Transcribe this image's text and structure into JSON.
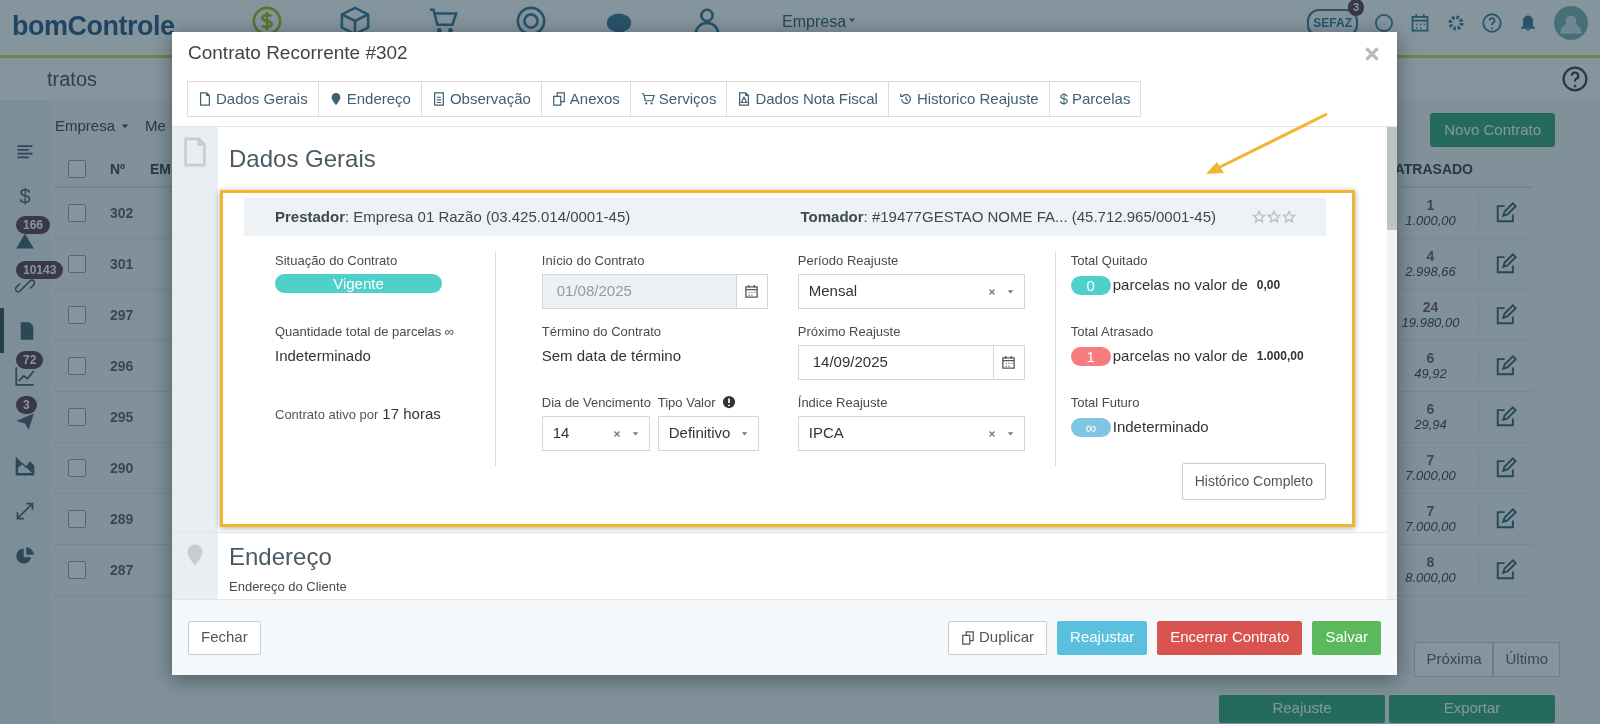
{
  "app": {
    "logo": "bomControle",
    "header_nav": [
      {
        "kind": "dollar",
        "selected": true
      },
      {
        "kind": "box",
        "selected": false
      },
      {
        "kind": "cart",
        "selected": false
      },
      {
        "kind": "target",
        "selected": false
      },
      {
        "kind": "piggy",
        "selected": false
      },
      {
        "kind": "people",
        "selected": false
      }
    ],
    "company_menu": "Empresa",
    "sefaz": {
      "label": "SEFAZ",
      "count": "3"
    },
    "page_title": "tratos",
    "filters": [
      "Empresa",
      "Me"
    ],
    "new_button": "Novo Contrato",
    "sidebar": [
      {
        "kind": "menu",
        "selected": false
      },
      {
        "kind": "dollar",
        "symbol": "$",
        "selected": false
      },
      {
        "kind": "warning",
        "badge": "166",
        "selected": false
      },
      {
        "kind": "link",
        "badge": "10143",
        "selected": false
      },
      {
        "kind": "document",
        "selected": true
      },
      {
        "kind": "chart",
        "badge": "72",
        "selected": false
      },
      {
        "kind": "send",
        "badge": "3",
        "selected": false
      },
      {
        "kind": "area",
        "selected": false
      },
      {
        "kind": "expand",
        "selected": false
      },
      {
        "kind": "pie",
        "selected": false
      }
    ],
    "table": {
      "columns": [
        "Nº",
        "EM",
        "ATRASADO"
      ],
      "select_all_checked": false,
      "rows": [
        {
          "checked": false,
          "number": "302",
          "late_count": "1",
          "late_value": "1.000,00"
        },
        {
          "checked": false,
          "number": "301",
          "late_count": "4",
          "late_value": "2.998,66"
        },
        {
          "checked": false,
          "number": "297",
          "late_count": "24",
          "late_value": "19.980,00"
        },
        {
          "checked": false,
          "number": "296",
          "late_count": "6",
          "late_value": "49,92"
        },
        {
          "checked": false,
          "number": "295",
          "late_count": "6",
          "late_value": "29,94"
        },
        {
          "checked": false,
          "number": "290",
          "late_count": "7",
          "late_value": "7.000,00"
        },
        {
          "checked": false,
          "number": "289",
          "late_count": "7",
          "late_value": "7.000,00"
        },
        {
          "checked": false,
          "number": "287",
          "late_count": "8",
          "late_value": "8.000,00"
        }
      ]
    },
    "pagination": [
      "Próxima",
      "Último"
    ],
    "bottom_buttons": [
      "Reajuste",
      "Exportar"
    ]
  },
  "modal": {
    "title": "Contrato Recorrente #302",
    "tabs": [
      {
        "label": "Dados Gerais",
        "kind": "file"
      },
      {
        "label": "Endereço",
        "kind": "pin"
      },
      {
        "label": "Observação",
        "kind": "doc"
      },
      {
        "label": "Anexos",
        "kind": "copy"
      },
      {
        "label": "Serviços",
        "kind": "cart"
      },
      {
        "label": "Dados Nota Fiscal",
        "kind": "pdf"
      },
      {
        "label": "Historico Reajuste",
        "kind": "history"
      },
      {
        "label": "Parcelas",
        "kind": "dollar",
        "symbol": "$"
      }
    ],
    "general": {
      "heading": "Dados Gerais",
      "prestador": "**Prestador**: Empresa 01 Razão (03.425.014/0001-45)",
      "tomador": "**Tomador**: #19477GESTAO NOME FA... (45.712.965/0001-45)",
      "stars": 0,
      "status_label": "Situação do Contrato",
      "status": "Vigente",
      "installments_label": "Quantidade total de parcelas ∞",
      "installments": "Indeterminado",
      "active_label": "Contrato ativo por",
      "active_value": "17 horas",
      "start_label": "Início do Contrato",
      "start": {
        "value": "01/08/2025",
        "disabled": true
      },
      "end_label": "Término do Contrato",
      "end": "Sem data de término",
      "due_day_label": "Dia de Vencimento",
      "due_day": "14",
      "value_type_label": "Tipo Valor",
      "value_type": "Definitivo",
      "period_label": "Período Reajuste",
      "period": "Mensal",
      "next_label": "Próximo Reajuste",
      "next": {
        "value": "14/09/2025",
        "disabled": false
      },
      "index_label": "Índice Reajuste",
      "index": "IPCA",
      "totals": [
        {
          "label": "Total Quitado",
          "count": "0",
          "color": "#4fd1c9",
          "text": "parcelas no valor de",
          "amount": "0,00"
        },
        {
          "label": "Total Atrasado",
          "count": "1",
          "color": "#f87b7d",
          "text": "parcelas no valor de",
          "amount": "1.000,00"
        },
        {
          "label": "Total Futuro",
          "count": "∞",
          "color": "#7fc6e4",
          "text": "Indeterminado"
        }
      ],
      "history_button": "Histórico Completo"
    },
    "address": {
      "heading": "Endereço",
      "label": "Endereço do Cliente"
    },
    "footer": {
      "close": "Fechar",
      "actions": [
        {
          "label": "Duplicar",
          "kind": "duplicate"
        },
        {
          "label": "Reajustar",
          "kind": "info"
        },
        {
          "label": "Encerrar Contrato",
          "kind": "danger"
        },
        {
          "label": "Salvar",
          "kind": "success"
        }
      ]
    }
  }
}
